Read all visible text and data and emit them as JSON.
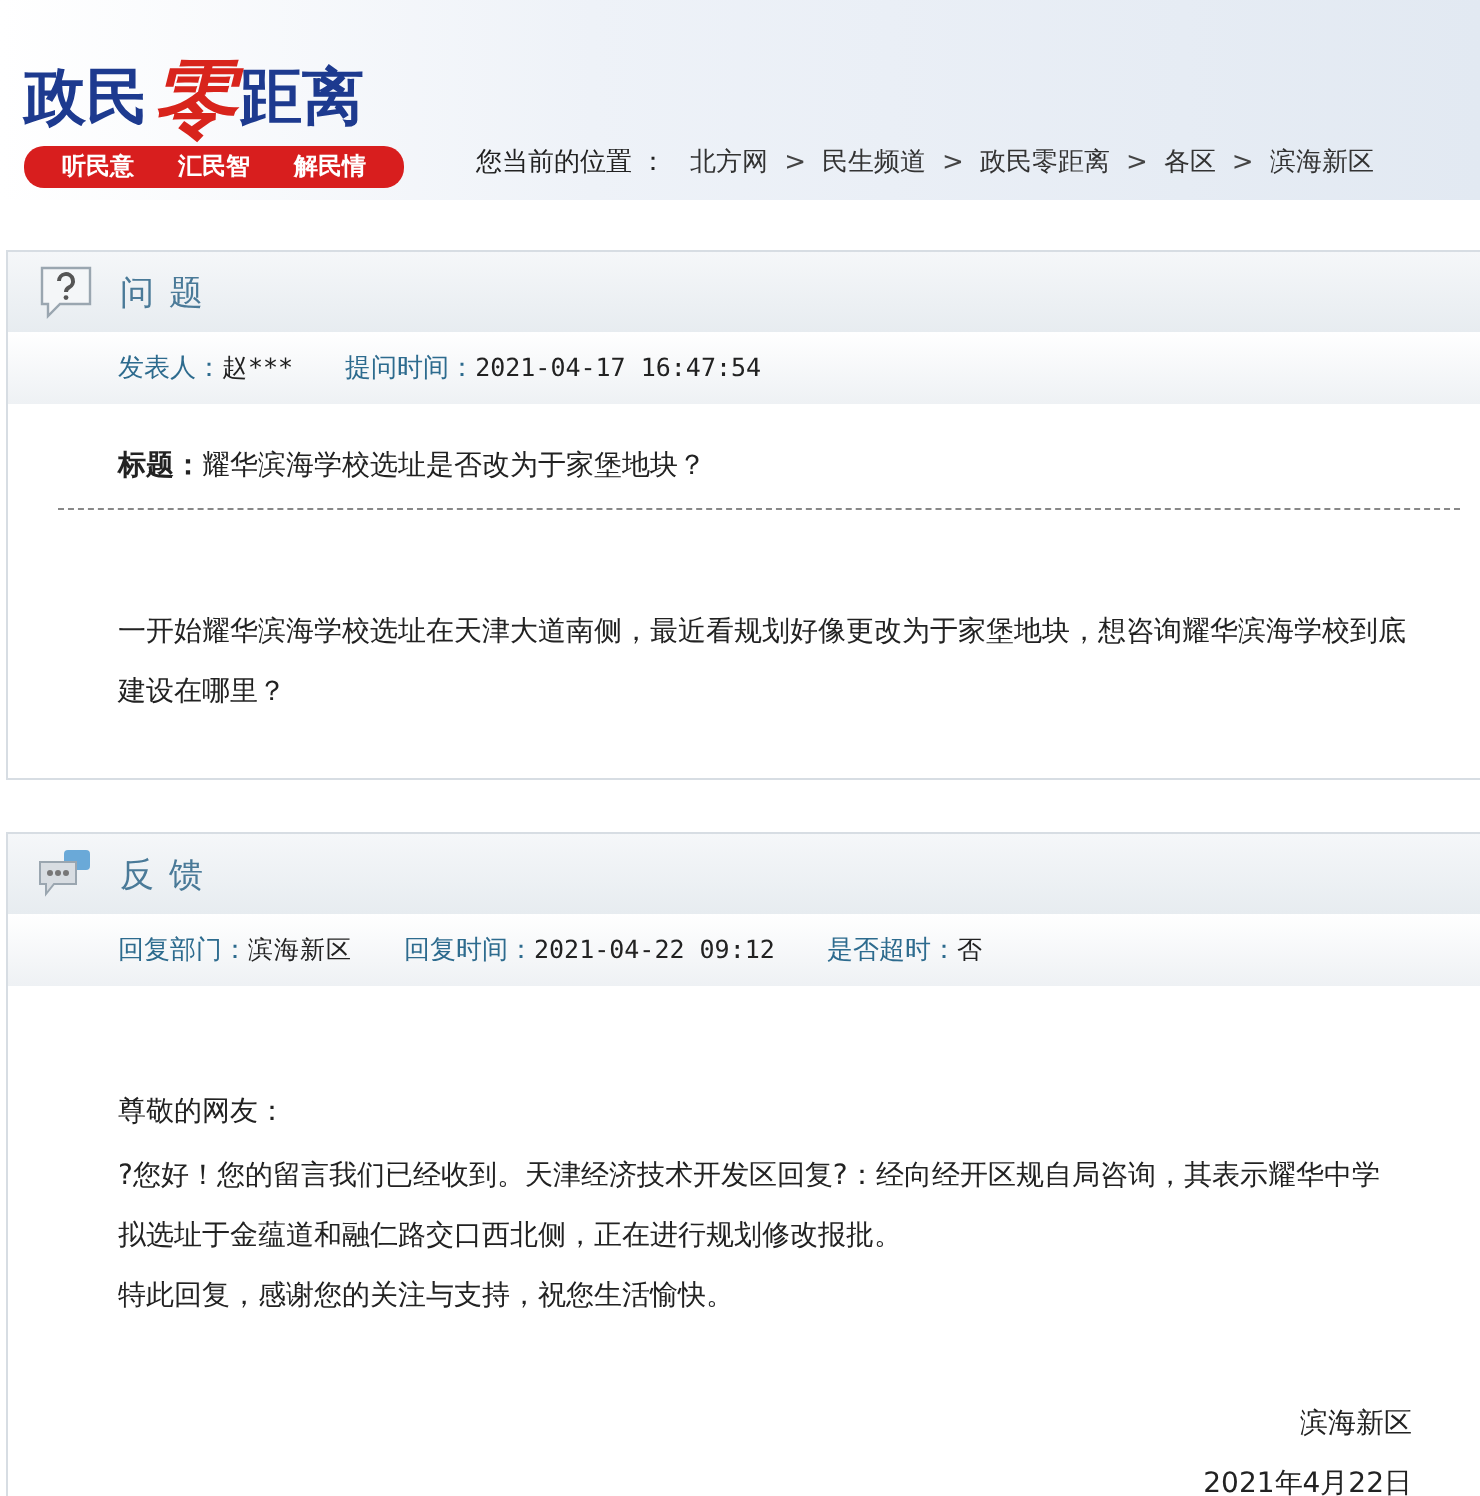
{
  "header": {
    "logo_parts": [
      {
        "text": "政民",
        "kind": "plain"
      },
      {
        "text": "零",
        "kind": "accent"
      },
      {
        "text": "距离",
        "kind": "plain"
      }
    ],
    "slogans": [
      "听民意",
      "汇民智",
      "解民情"
    ],
    "breadcrumb": {
      "label": "您当前的位置 ：",
      "items": [
        "北方网",
        "民生频道",
        "政民零距离",
        "各区",
        "滨海新区"
      ],
      "separator": ">"
    }
  },
  "question": {
    "title": "问 题",
    "meta": [
      {
        "label": "发表人：",
        "value": "赵***"
      },
      {
        "label": "提问时间：",
        "value": "2021-04-17 16:47:54"
      }
    ],
    "subject_label": "标题：",
    "subject": "耀华滨海学校选址是否改为于家堡地块？",
    "body": "一开始耀华滨海学校选址在天津大道南侧，最近看规划好像更改为于家堡地块，想咨询耀华滨海学校到底建设在哪里？"
  },
  "feedback": {
    "title": "反 馈",
    "meta": [
      {
        "label": "回复部门：",
        "value": "滨海新区"
      },
      {
        "label": "回复时间：",
        "value": "2021-04-22 09:12"
      },
      {
        "label": "是否超时：",
        "value": "否"
      }
    ],
    "greeting": "尊敬的网友：",
    "paragraphs": [
      "?您好！您的留言我们已经收到。天津经济技术开发区回复?：经向经开区规自局咨询，其表示耀华中学拟选址于金蕴道和融仁路交口西北侧，正在进行规划修改报批。",
      "特此回复，感谢您的关注与支持，祝您生活愉快。"
    ],
    "signature": "滨海新区",
    "date": "2021年4月22日"
  }
}
